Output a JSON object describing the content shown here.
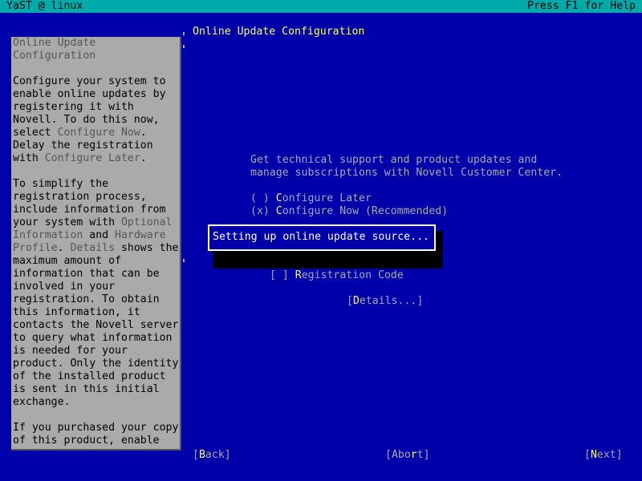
{
  "topbar": {
    "left": "YaST @ linux",
    "right": "Press F1 for Help"
  },
  "help": {
    "title_line1": "Online Update",
    "title_line2": "Configuration",
    "lines": [
      "",
      "Configure your system to",
      "enable online updates by",
      "registering it with",
      "Novell. To do this now,",
      [
        "select ",
        "Configure Now",
        "."
      ],
      "Delay the registration",
      [
        "with ",
        "Configure Later",
        "."
      ],
      "",
      "To simplify the",
      "registration process,",
      "include information from",
      [
        "your system with ",
        "Optional",
        ""
      ],
      [
        "",
        "Information",
        " and ",
        "Hardware",
        ""
      ],
      [
        "",
        "Profile",
        ". ",
        "Details",
        " shows the"
      ],
      "maximum amount of",
      "information that can be",
      "involved in your",
      "registration. To obtain",
      "this information, it",
      "contacts the Novell server",
      "to query what information",
      "is needed for your",
      "product. Only the identity",
      "of the installed product",
      "is sent in this initial",
      "exchange.",
      "",
      "If you purchased your copy",
      "of this product, enable"
    ]
  },
  "dialog": {
    "title": "Online Update Configuration",
    "intro_line1": "Get technical support and product updates and",
    "intro_line2": "manage subscriptions with Novell Customer Center.",
    "radio_later": {
      "mark": "( )",
      "label_prefix": "",
      "hotkey": "C",
      "label_rest": "onfigure Later"
    },
    "radio_now": {
      "mark": "(x)",
      "label_prefix": "",
      "hotkey": "C",
      "label_rest": "onfigure Now (Recommended)"
    },
    "progress": "Setting up online update source...",
    "registration_code": {
      "mark": "[ ]",
      "hotkey": "R",
      "label_rest": "egistration Code"
    },
    "details": {
      "open": "[",
      "hotkey": "D",
      "rest": "etails...]"
    }
  },
  "buttons": {
    "back": {
      "open": "[",
      "hotkey": "B",
      "rest": "ack]"
    },
    "abort": {
      "open": "[Abo",
      "hotkey": "r",
      "rest": "t]"
    },
    "next": {
      "open": "[",
      "hotkey": "N",
      "rest": "ext]"
    }
  }
}
